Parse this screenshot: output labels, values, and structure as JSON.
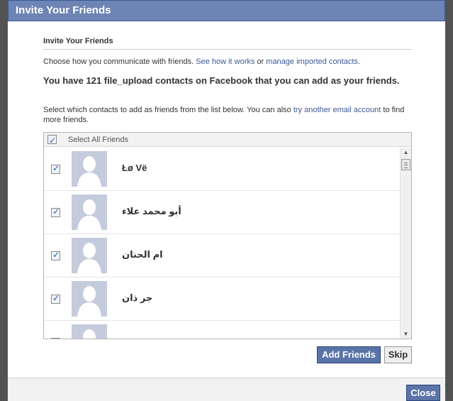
{
  "dialog": {
    "title": "Invite Your Friends",
    "section_title": "Invite Your Friends",
    "intro": {
      "text_before": "Choose how you communicate with friends. ",
      "link1": "See how it works",
      "text_or": " or ",
      "link2": "manage imported contacts",
      "text_after": "."
    },
    "headline": "You have 121 file_upload contacts on Facebook that you can add as your friends.",
    "select_instruction": {
      "text_before": "Select which contacts to add as friends from the list below. You can also ",
      "link": "try another email account",
      "text_after": " to find more friends."
    },
    "select_all_label": "Select All Friends",
    "select_all_checked": true,
    "contacts": [
      {
        "name": "Łø Vë",
        "checked": true
      },
      {
        "name": "أبو محمد علاء",
        "checked": true
      },
      {
        "name": "ام الحنان",
        "checked": true
      },
      {
        "name": "جر ذان",
        "checked": true
      },
      {
        "name": "",
        "checked": true
      }
    ],
    "buttons": {
      "add_friends": "Add Friends",
      "skip": "Skip",
      "close": "Close"
    },
    "colors": {
      "title_bar": "#6d84b4",
      "link": "#3b5998",
      "primary_button": "#5b74a8",
      "avatar_placeholder": "#c3cbdc"
    }
  }
}
